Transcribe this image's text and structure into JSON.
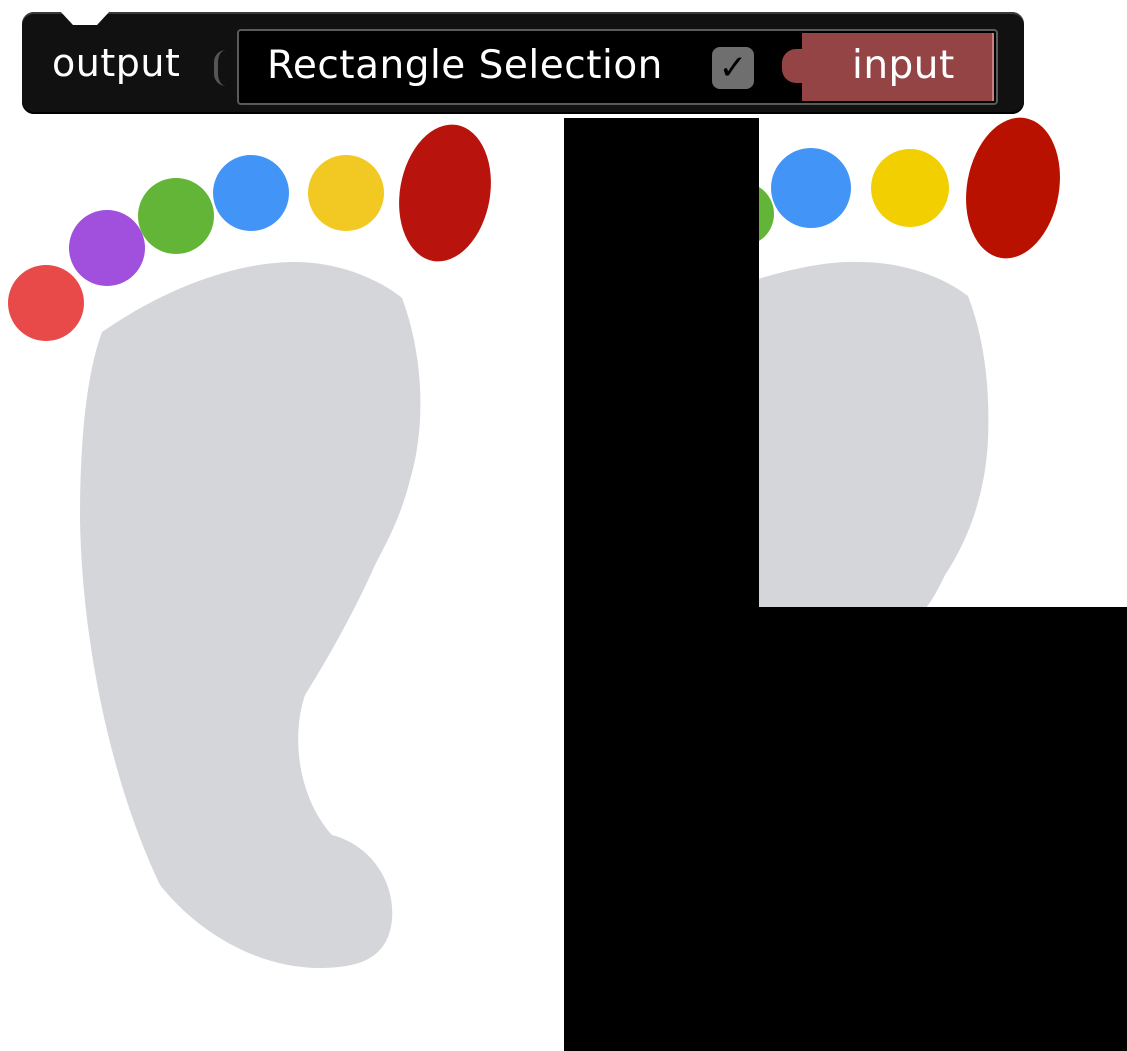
{
  "block": {
    "output_label": "output",
    "selection_label": "Rectangle Selection",
    "checkbox_checked": true,
    "checkbox_glyph": "✓",
    "input_label": "input",
    "colors": {
      "block_bg": "#111111",
      "input_plug": "#944444",
      "checkbox": "#6f6f6f"
    }
  },
  "images": {
    "left": {
      "name": "footprint",
      "toe_colors": [
        "#e84a4a",
        "#a050dc",
        "#62b536",
        "#4294f7",
        "#f2c922",
        "#b8130d"
      ],
      "sole_color": "#d5d6da"
    },
    "right": {
      "name": "footprint-masked",
      "toe_colors": [
        "#62b536",
        "#4294f7",
        "#f2cf00",
        "#b81100"
      ],
      "sole_color": "#d5d6da",
      "mask_color": "#000000",
      "mask_shape": "L-shape"
    }
  }
}
